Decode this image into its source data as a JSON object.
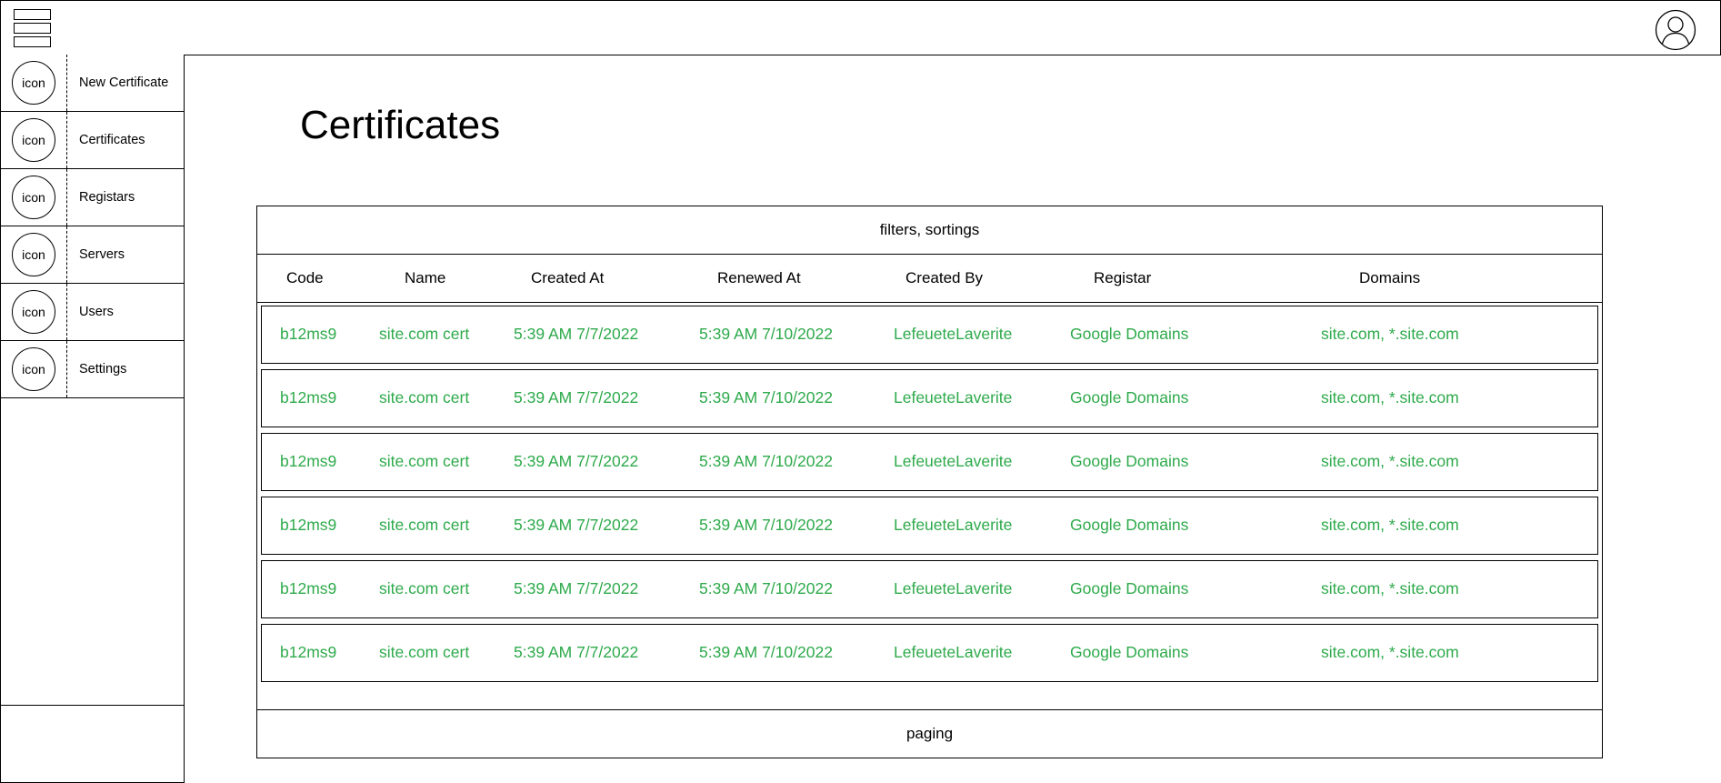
{
  "header": {
    "menu_icon": "hamburger-icon",
    "avatar_icon": "user-avatar-icon"
  },
  "sidebar": {
    "items": [
      {
        "icon_text": "icon",
        "label": "New Certificate"
      },
      {
        "icon_text": "icon",
        "label": "Certificates"
      },
      {
        "icon_text": "icon",
        "label": "Registars"
      },
      {
        "icon_text": "icon",
        "label": "Servers"
      },
      {
        "icon_text": "icon",
        "label": "Users"
      },
      {
        "icon_text": "icon",
        "label": "Settings"
      }
    ]
  },
  "main": {
    "title": "Certificates",
    "filters_label": "filters, sortings",
    "paging_label": "paging",
    "columns": [
      "Code",
      "Name",
      "Created At",
      "Renewed At",
      "Created By",
      "Registar",
      "Domains"
    ],
    "rows": [
      [
        "b12ms9",
        "site.com cert",
        "5:39 AM 7/7/2022",
        "5:39 AM 7/10/2022",
        "LefeueteLaverite",
        "Google Domains",
        "site.com, *.site.com"
      ],
      [
        "b12ms9",
        "site.com cert",
        "5:39 AM 7/7/2022",
        "5:39 AM 7/10/2022",
        "LefeueteLaverite",
        "Google Domains",
        "site.com, *.site.com"
      ],
      [
        "b12ms9",
        "site.com cert",
        "5:39 AM 7/7/2022",
        "5:39 AM 7/10/2022",
        "LefeueteLaverite",
        "Google Domains",
        "site.com, *.site.com"
      ],
      [
        "b12ms9",
        "site.com cert",
        "5:39 AM 7/7/2022",
        "5:39 AM 7/10/2022",
        "LefeueteLaverite",
        "Google Domains",
        "site.com, *.site.com"
      ],
      [
        "b12ms9",
        "site.com cert",
        "5:39 AM 7/7/2022",
        "5:39 AM 7/10/2022",
        "LefeueteLaverite",
        "Google Domains",
        "site.com, *.site.com"
      ],
      [
        "b12ms9",
        "site.com cert",
        "5:39 AM 7/7/2022",
        "5:39 AM 7/10/2022",
        "LefeueteLaverite",
        "Google Domains",
        "site.com, *.site.com"
      ]
    ]
  },
  "colors": {
    "row_text": "#2eaa4b",
    "border": "#000000"
  }
}
